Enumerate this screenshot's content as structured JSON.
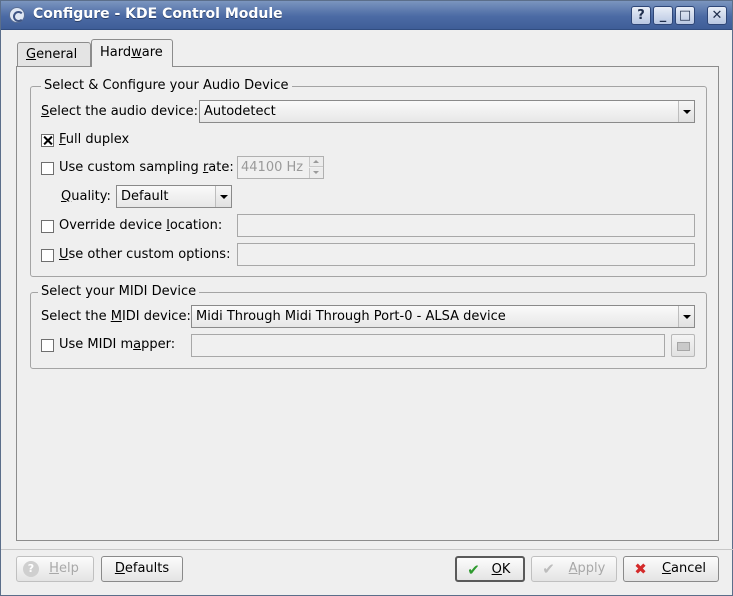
{
  "window": {
    "title": "Configure - KDE Control Module",
    "controls": {
      "help": "?",
      "minimize": "_",
      "maximize": "□",
      "close": "✕"
    }
  },
  "tabs": [
    {
      "label": "General",
      "mnemonic": "G",
      "rest": "eneral",
      "active": false
    },
    {
      "label": "Hardware",
      "pre": "Hard",
      "mnemonic": "w",
      "post": "are",
      "active": true
    }
  ],
  "audio_group": {
    "title": "Select & Configure your Audio Device",
    "device_label_pre": "",
    "device_label_mn": "S",
    "device_label_post": "elect the audio device:",
    "device_value": "Autodetect",
    "full_duplex": {
      "mn": "F",
      "post": "ull duplex",
      "checked": true
    },
    "sampling": {
      "pre": "Use custom sampling ",
      "mn": "r",
      "post": "ate:",
      "checked": false,
      "value": "44100 Hz"
    },
    "quality": {
      "mn": "Q",
      "post": "uality:",
      "value": "Default"
    },
    "override": {
      "pre": "Override device ",
      "mn": "l",
      "post": "ocation:",
      "checked": false,
      "value": ""
    },
    "custom_options": {
      "mn": "U",
      "post": "se other custom options:",
      "checked": false,
      "value": ""
    }
  },
  "midi_group": {
    "title": "Select your MIDI Device",
    "device_label_pre": "Select the ",
    "device_label_mn": "M",
    "device_label_post": "IDI device:",
    "device_value": "Midi Through  Midi Through Port-0 - ALSA device",
    "mapper": {
      "pre": "Use MIDI m",
      "mn": "a",
      "post": "pper:",
      "checked": false,
      "value": ""
    }
  },
  "buttons": {
    "help": {
      "mn": "H",
      "post": "elp",
      "enabled": false
    },
    "defaults": {
      "mn": "D",
      "post": "efaults",
      "enabled": true
    },
    "ok": {
      "mn": "O",
      "post": "K",
      "enabled": true
    },
    "apply": {
      "mn": "A",
      "post": "pply",
      "enabled": false
    },
    "cancel": {
      "mn": "C",
      "post": "ancel",
      "enabled": true
    }
  },
  "colors": {
    "titlebar": "#4b6aa4",
    "ok_check": "#2e9a2e",
    "cancel_x": "#d42a2a"
  }
}
